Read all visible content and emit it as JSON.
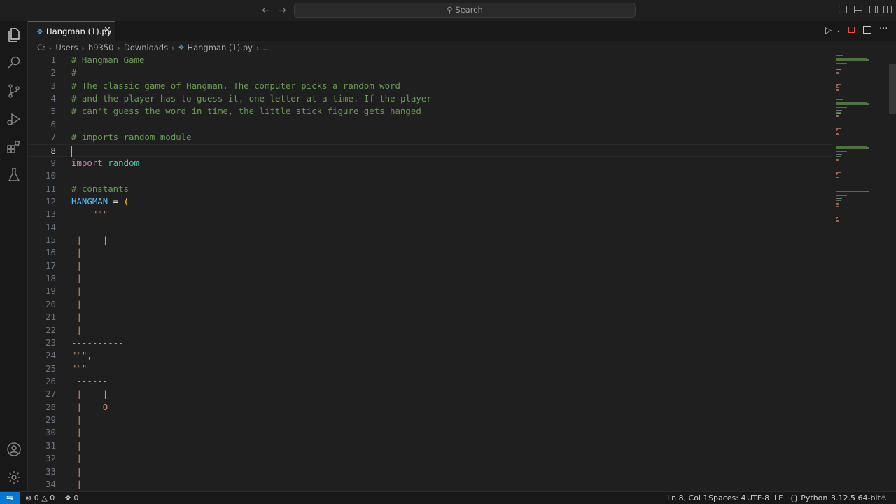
{
  "titlebar": {
    "search_placeholder": "Search"
  },
  "activitybar": {
    "items": [
      "Explorer",
      "Search",
      "Source Control",
      "Run and Debug",
      "Extensions",
      "Testing"
    ],
    "bottom_items": [
      "Accounts",
      "Manage"
    ]
  },
  "tab": {
    "label": "Hangman (1).py"
  },
  "breadcrumb": {
    "parts": [
      "C:",
      "Users",
      "h9350",
      "Downloads"
    ],
    "file": "Hangman (1).py",
    "more": "..."
  },
  "editor": {
    "lines": [
      {
        "n": "1",
        "tokens": [
          [
            "comment",
            "# Hangman Game"
          ]
        ]
      },
      {
        "n": "2",
        "tokens": [
          [
            "comment",
            "#"
          ]
        ]
      },
      {
        "n": "3",
        "tokens": [
          [
            "comment",
            "# The classic game of Hangman. The computer picks a random word"
          ]
        ]
      },
      {
        "n": "4",
        "tokens": [
          [
            "comment",
            "# and the player has to guess it, one letter at a time. If the player"
          ]
        ]
      },
      {
        "n": "5",
        "tokens": [
          [
            "comment",
            "# can't guess the word in time, the little stick figure gets hanged"
          ]
        ]
      },
      {
        "n": "6",
        "tokens": []
      },
      {
        "n": "7",
        "tokens": [
          [
            "comment",
            "# imports random module"
          ]
        ]
      },
      {
        "n": "8",
        "tokens": [],
        "current": true
      },
      {
        "n": "9",
        "tokens": [
          [
            "keyword",
            "import"
          ],
          [
            "plain",
            " "
          ],
          [
            "module",
            "random"
          ]
        ]
      },
      {
        "n": "10",
        "tokens": []
      },
      {
        "n": "11",
        "tokens": [
          [
            "comment",
            "# constants"
          ]
        ]
      },
      {
        "n": "12",
        "tokens": [
          [
            "const",
            "HANGMAN"
          ],
          [
            "op",
            " = "
          ],
          [
            "paren",
            "("
          ]
        ]
      },
      {
        "n": "13",
        "tokens": [
          [
            "string",
            "    \"\"\""
          ]
        ]
      },
      {
        "n": "14",
        "tokens": [
          [
            "string",
            " ------"
          ]
        ]
      },
      {
        "n": "15",
        "tokens": [
          [
            "string",
            " |    |"
          ]
        ]
      },
      {
        "n": "16",
        "tokens": [
          [
            "string",
            " |"
          ]
        ]
      },
      {
        "n": "17",
        "tokens": [
          [
            "string",
            " |"
          ]
        ]
      },
      {
        "n": "18",
        "tokens": [
          [
            "string",
            " |"
          ]
        ]
      },
      {
        "n": "19",
        "tokens": [
          [
            "string",
            " |"
          ]
        ]
      },
      {
        "n": "20",
        "tokens": [
          [
            "string",
            " |"
          ]
        ]
      },
      {
        "n": "21",
        "tokens": [
          [
            "string",
            " |"
          ]
        ]
      },
      {
        "n": "22",
        "tokens": [
          [
            "string",
            " |"
          ]
        ]
      },
      {
        "n": "23",
        "tokens": [
          [
            "string",
            "----------"
          ]
        ]
      },
      {
        "n": "24",
        "tokens": [
          [
            "string",
            "\"\"\""
          ],
          [
            "op",
            ","
          ]
        ]
      },
      {
        "n": "25",
        "tokens": [
          [
            "string",
            "\"\"\""
          ]
        ]
      },
      {
        "n": "26",
        "tokens": [
          [
            "string",
            " ------"
          ]
        ]
      },
      {
        "n": "27",
        "tokens": [
          [
            "string",
            " |    |"
          ]
        ]
      },
      {
        "n": "28",
        "tokens": [
          [
            "string",
            " |    O"
          ]
        ]
      },
      {
        "n": "29",
        "tokens": [
          [
            "string",
            " |"
          ]
        ]
      },
      {
        "n": "30",
        "tokens": [
          [
            "string",
            " |"
          ]
        ]
      },
      {
        "n": "31",
        "tokens": [
          [
            "string",
            " |"
          ]
        ]
      },
      {
        "n": "32",
        "tokens": [
          [
            "string",
            " |"
          ]
        ]
      },
      {
        "n": "33",
        "tokens": [
          [
            "string",
            " |"
          ]
        ]
      },
      {
        "n": "34",
        "tokens": [
          [
            "string",
            " |"
          ]
        ]
      }
    ]
  },
  "statusbar": {
    "errors": "0",
    "warnings": "0",
    "ports": "0",
    "position": "Ln 8, Col 1",
    "indent": "Spaces: 4",
    "encoding": "UTF-8",
    "eol": "LF",
    "language": "Python",
    "interpreter": "3.12.5 64-bit"
  },
  "colors": {
    "accent": "#0078d4",
    "comment": "#6a9955",
    "string": "#ce9178"
  }
}
